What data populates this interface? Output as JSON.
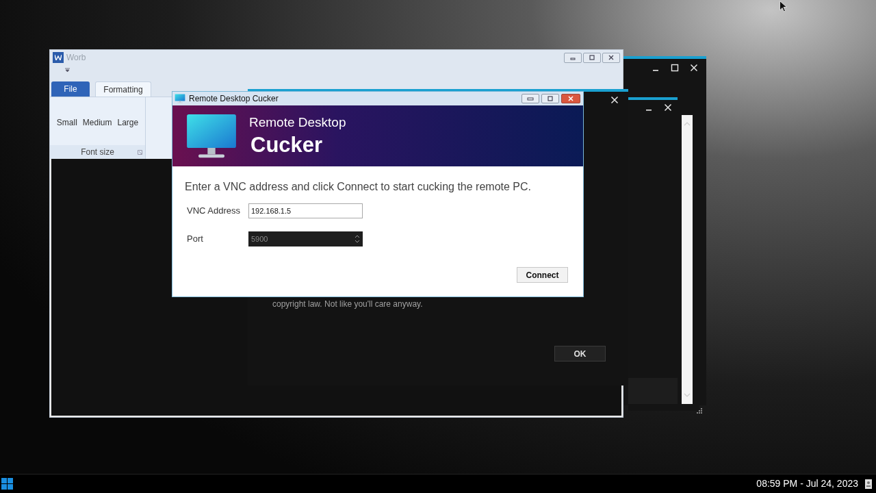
{
  "word_window": {
    "title": "Worb",
    "tabs": [
      {
        "label": "File",
        "kind": "menu",
        "selected": false
      },
      {
        "label": "Formatting",
        "kind": "tab",
        "selected": true
      }
    ],
    "buttons": [
      "Small",
      "Medium",
      "Large"
    ],
    "group_label": "Font size"
  },
  "message_dialog": {
    "text": "copyright law. Not like you'll care anyway.",
    "button": "OK"
  },
  "dialog": {
    "title": "Remote Desktop Cucker",
    "heading": "Remote Desktop",
    "app_name": "Cucker",
    "instruction": "Enter a VNC address and click Connect to start cucking the remote PC.",
    "fields": [
      {
        "label": "VNC Address",
        "value": "192.168.1.5",
        "kind": "text",
        "disabled": false
      },
      {
        "label": "Port",
        "value": "5900",
        "kind": "spinner",
        "disabled": true
      }
    ],
    "button": "Connect"
  },
  "taskbar": {
    "clock": "08:59 PM - Jul 24, 2023"
  }
}
